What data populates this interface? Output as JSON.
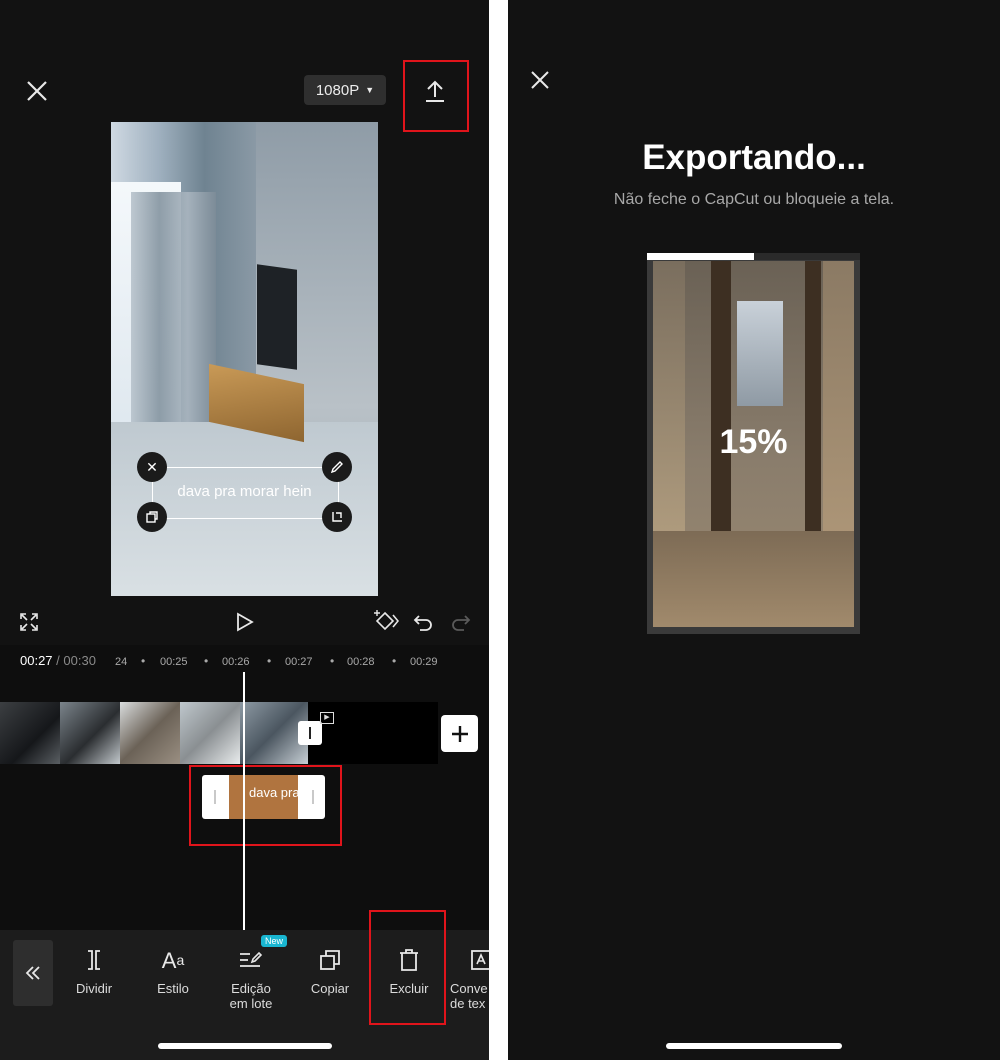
{
  "editor": {
    "resolution": "1080P",
    "current_time": "00:27",
    "separator": "/",
    "total_time": "00:30",
    "ruler": [
      "24",
      "00:25",
      "00:26",
      "00:27",
      "00:28",
      "00:29"
    ],
    "text_overlay": "dava pra morar hein",
    "text_clip_label": "dava pra",
    "new_badge": "New",
    "tools": [
      {
        "label": "Dividir"
      },
      {
        "label": "Estilo"
      },
      {
        "label": "Edição\nem lote"
      },
      {
        "label": "Copiar"
      },
      {
        "label": "Excluir"
      },
      {
        "label": "Conve\nde tex"
      }
    ]
  },
  "export": {
    "title": "Exportando...",
    "subtitle": "Não feche o CapCut ou bloqueie a tela.",
    "progress_label": "15%",
    "progress_fraction": 0.5
  },
  "colors": {
    "background": "#121212",
    "highlight": "#e0141b",
    "text_clip": "#b0743f"
  }
}
